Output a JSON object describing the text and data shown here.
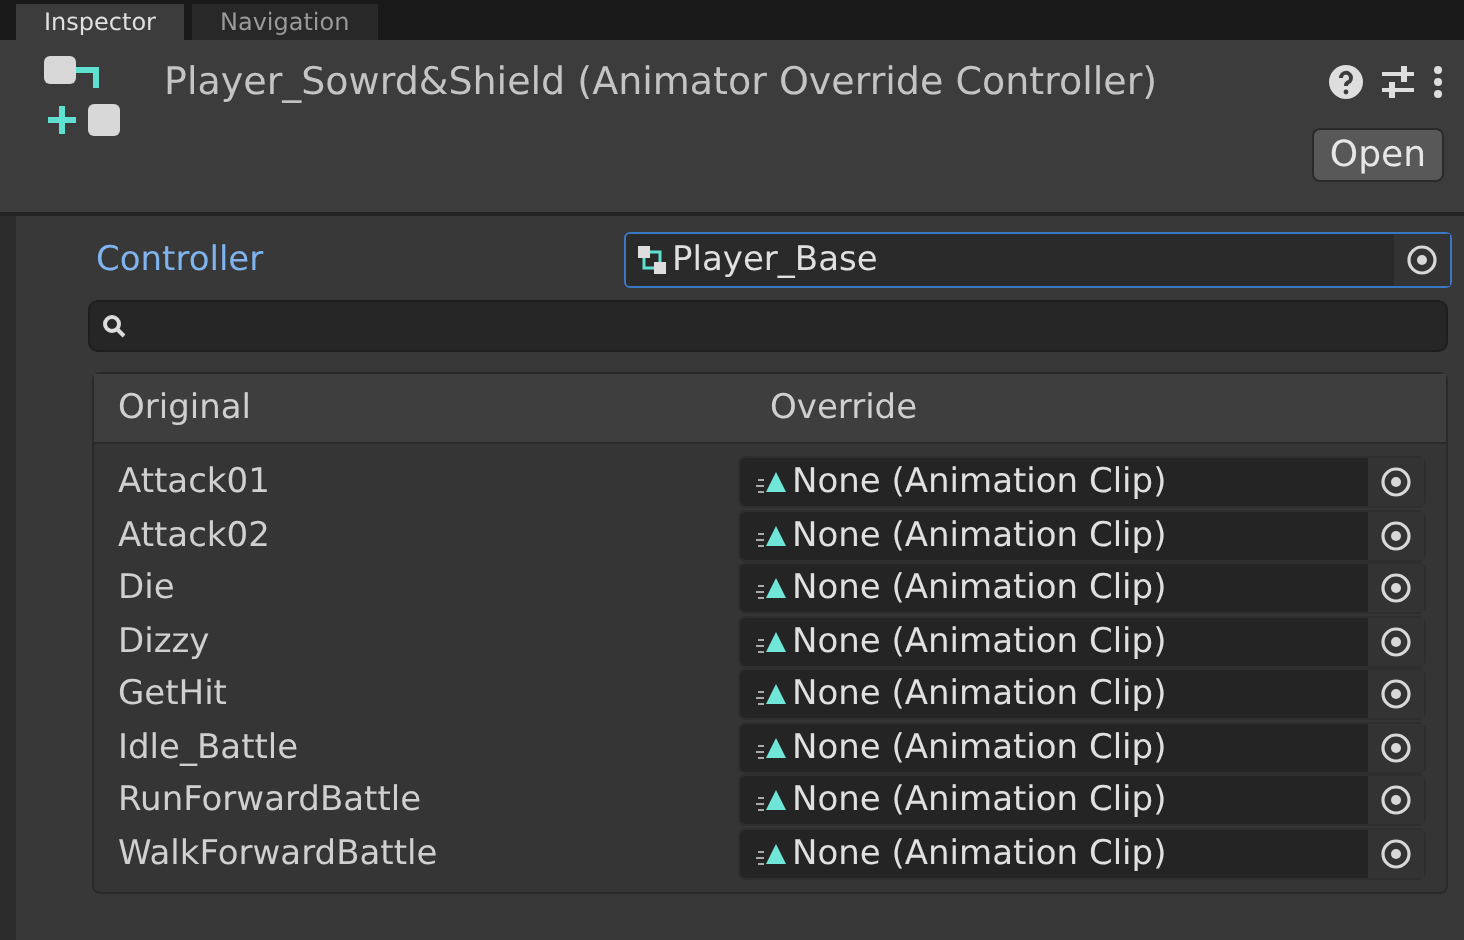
{
  "tabs": [
    {
      "label": "Inspector",
      "selected": true
    },
    {
      "label": "Navigation",
      "selected": false
    }
  ],
  "header": {
    "title": "Player_Sowrd&Shield (Animator Override Controller)",
    "open_button": "Open"
  },
  "controller": {
    "label": "Controller",
    "value": "Player_Base"
  },
  "table": {
    "columns": [
      "Original",
      "Override"
    ],
    "rows": [
      {
        "original": "Attack01",
        "override": "None (Animation Clip)"
      },
      {
        "original": "Attack02",
        "override": "None (Animation Clip)"
      },
      {
        "original": "Die",
        "override": "None (Animation Clip)"
      },
      {
        "original": "Dizzy",
        "override": "None (Animation Clip)"
      },
      {
        "original": "GetHit",
        "override": "None (Animation Clip)"
      },
      {
        "original": "Idle_Battle",
        "override": "None (Animation Clip)"
      },
      {
        "original": "RunForwardBattle",
        "override": "None (Animation Clip)"
      },
      {
        "original": "WalkForwardBattle",
        "override": "None (Animation Clip)"
      }
    ]
  }
}
